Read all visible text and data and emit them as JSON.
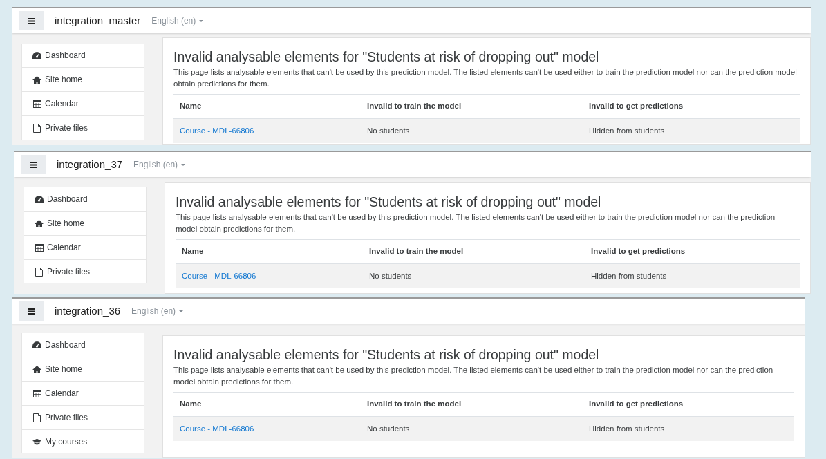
{
  "panels": [
    {
      "site_name": "integration_master",
      "language": "English (en)",
      "nav_items": [
        {
          "kind": "dashboard",
          "label": "Dashboard"
        },
        {
          "kind": "home",
          "label": "Site home"
        },
        {
          "kind": "calendar",
          "label": "Calendar"
        },
        {
          "kind": "file",
          "label": "Private files"
        }
      ],
      "heading": "Invalid analysable elements for \"Students at risk of dropping out\" model",
      "description": "This page lists analysable elements that can't be used by this prediction model. The listed elements can't be used either to train the prediction model nor can the prediction model obtain predictions for them.",
      "table": {
        "columns": [
          "Name",
          "Invalid to train the model",
          "Invalid to get predictions"
        ],
        "rows": [
          [
            "Course - MDL-66806",
            "No students",
            "Hidden from students"
          ]
        ]
      }
    },
    {
      "site_name": "integration_37",
      "language": "English (en)",
      "nav_items": [
        {
          "kind": "dashboard",
          "label": "Dashboard"
        },
        {
          "kind": "home",
          "label": "Site home"
        },
        {
          "kind": "calendar",
          "label": "Calendar"
        },
        {
          "kind": "file",
          "label": "Private files"
        }
      ],
      "heading": "Invalid analysable elements for \"Students at risk of dropping out\" model",
      "description": "This page lists analysable elements that can't be used by this prediction model. The listed elements can't be used either to train the prediction model nor can the prediction model obtain predictions for them.",
      "table": {
        "columns": [
          "Name",
          "Invalid to train the model",
          "Invalid to get predictions"
        ],
        "rows": [
          [
            "Course - MDL-66806",
            "No students",
            "Hidden from students"
          ]
        ]
      }
    },
    {
      "site_name": "integration_36",
      "language": "English (en)",
      "nav_items": [
        {
          "kind": "dashboard",
          "label": "Dashboard"
        },
        {
          "kind": "home",
          "label": "Site home"
        },
        {
          "kind": "calendar",
          "label": "Calendar"
        },
        {
          "kind": "file",
          "label": "Private files"
        },
        {
          "kind": "courses",
          "label": "My courses"
        }
      ],
      "heading": "Invalid analysable elements for \"Students at risk of dropping out\" model",
      "description": "This page lists analysable elements that can't be used by this prediction model. The listed elements can't be used either to train the prediction model nor can the prediction model obtain predictions for them.",
      "table": {
        "columns": [
          "Name",
          "Invalid to train the model",
          "Invalid to get predictions"
        ],
        "rows": [
          [
            "Course - MDL-66806",
            "No students",
            "Hidden from students"
          ]
        ]
      }
    }
  ]
}
